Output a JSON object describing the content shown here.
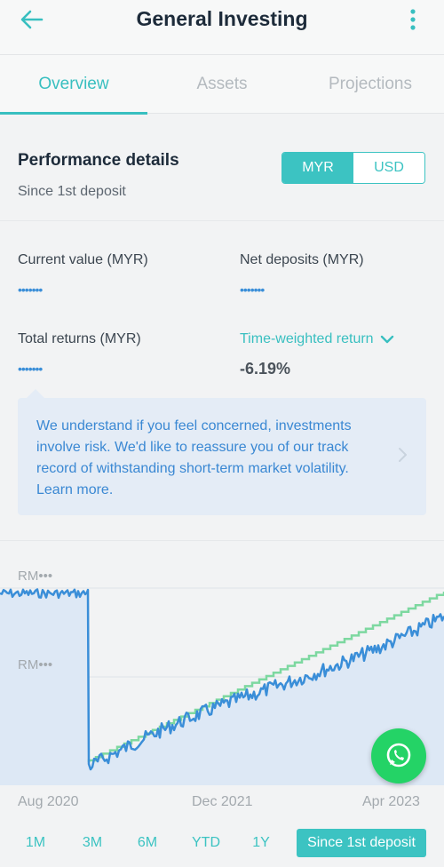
{
  "header": {
    "title": "General Investing"
  },
  "tabs": [
    {
      "label": "Overview",
      "active": true
    },
    {
      "label": "Assets",
      "active": false
    },
    {
      "label": "Projections",
      "active": false
    }
  ],
  "performance": {
    "title": "Performance details",
    "subtitle": "Since 1st deposit",
    "currency_options": [
      "MYR",
      "USD"
    ],
    "currency_selected": "MYR",
    "current_value_label": "Current value (MYR)",
    "current_value": "•••••••",
    "net_deposits_label": "Net deposits (MYR)",
    "net_deposits": "•••••••",
    "total_returns_label": "Total returns (MYR)",
    "total_returns": "•••••••",
    "twr_label": "Time-weighted return",
    "twr_value": "-6.19%"
  },
  "notice": {
    "text": "We understand if you feel concerned, investments involve risk. We'd like to reassure you of our track record of withstanding short-term market volatility. Learn more."
  },
  "chart": {
    "y_labels": [
      "RM•••",
      "RM•••"
    ],
    "x_labels": [
      "Aug 2020",
      "Dec 2021",
      "Apr 2023"
    ],
    "colors": {
      "portfolio": "#3a8ed8",
      "deposits": "#7dd8a0",
      "fill": "#dde8f5"
    }
  },
  "chart_data": {
    "type": "line",
    "x": [
      "Aug 2020",
      "Dec 2021",
      "Apr 2023"
    ],
    "series": [],
    "xlabel": "",
    "ylabel": "",
    "grid": true
  },
  "ranges": [
    "1M",
    "3M",
    "6M",
    "YTD",
    "1Y",
    "Since 1st deposit"
  ],
  "range_selected": "Since 1st deposit",
  "icons": {
    "back": "back-arrow-icon",
    "menu": "more-vertical-icon",
    "chevron": "chevron-down-icon",
    "arrow": "chevron-right-icon",
    "whatsapp": "whatsapp-icon"
  }
}
